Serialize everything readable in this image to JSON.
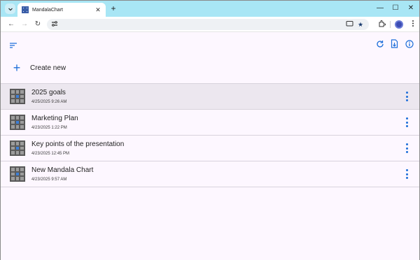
{
  "browser": {
    "tab_title": "MandalaChart",
    "tab_close_glyph": "✕",
    "new_tab_glyph": "+",
    "controls": {
      "minimize": "—",
      "maximize": "☐",
      "close": "✕"
    },
    "nav": {
      "back": "←",
      "forward": "→",
      "reload": "↻"
    },
    "omnibox_icons": [
      "site-info-icon",
      "cast-icon",
      "star-icon"
    ],
    "toolbar_icons": [
      "extensions-icon",
      "profile-icon",
      "menu-icon"
    ]
  },
  "app": {
    "toolbar_icons": [
      "sort-icon",
      "refresh-icon",
      "import-icon",
      "info-icon"
    ],
    "create_label": "Create new",
    "accent_color": "#1e6fd9",
    "charts": [
      {
        "title": "2025 goals",
        "date": "4/25/2025 9:26 AM",
        "selected": true
      },
      {
        "title": "Marketing Plan",
        "date": "4/23/2025 1:22 PM",
        "selected": false
      },
      {
        "title": "Key points of the presentation",
        "date": "4/23/2025 12:45 PM",
        "selected": false
      },
      {
        "title": "New Mandala Chart",
        "date": "4/23/2025 9:57 AM",
        "selected": false
      }
    ]
  }
}
